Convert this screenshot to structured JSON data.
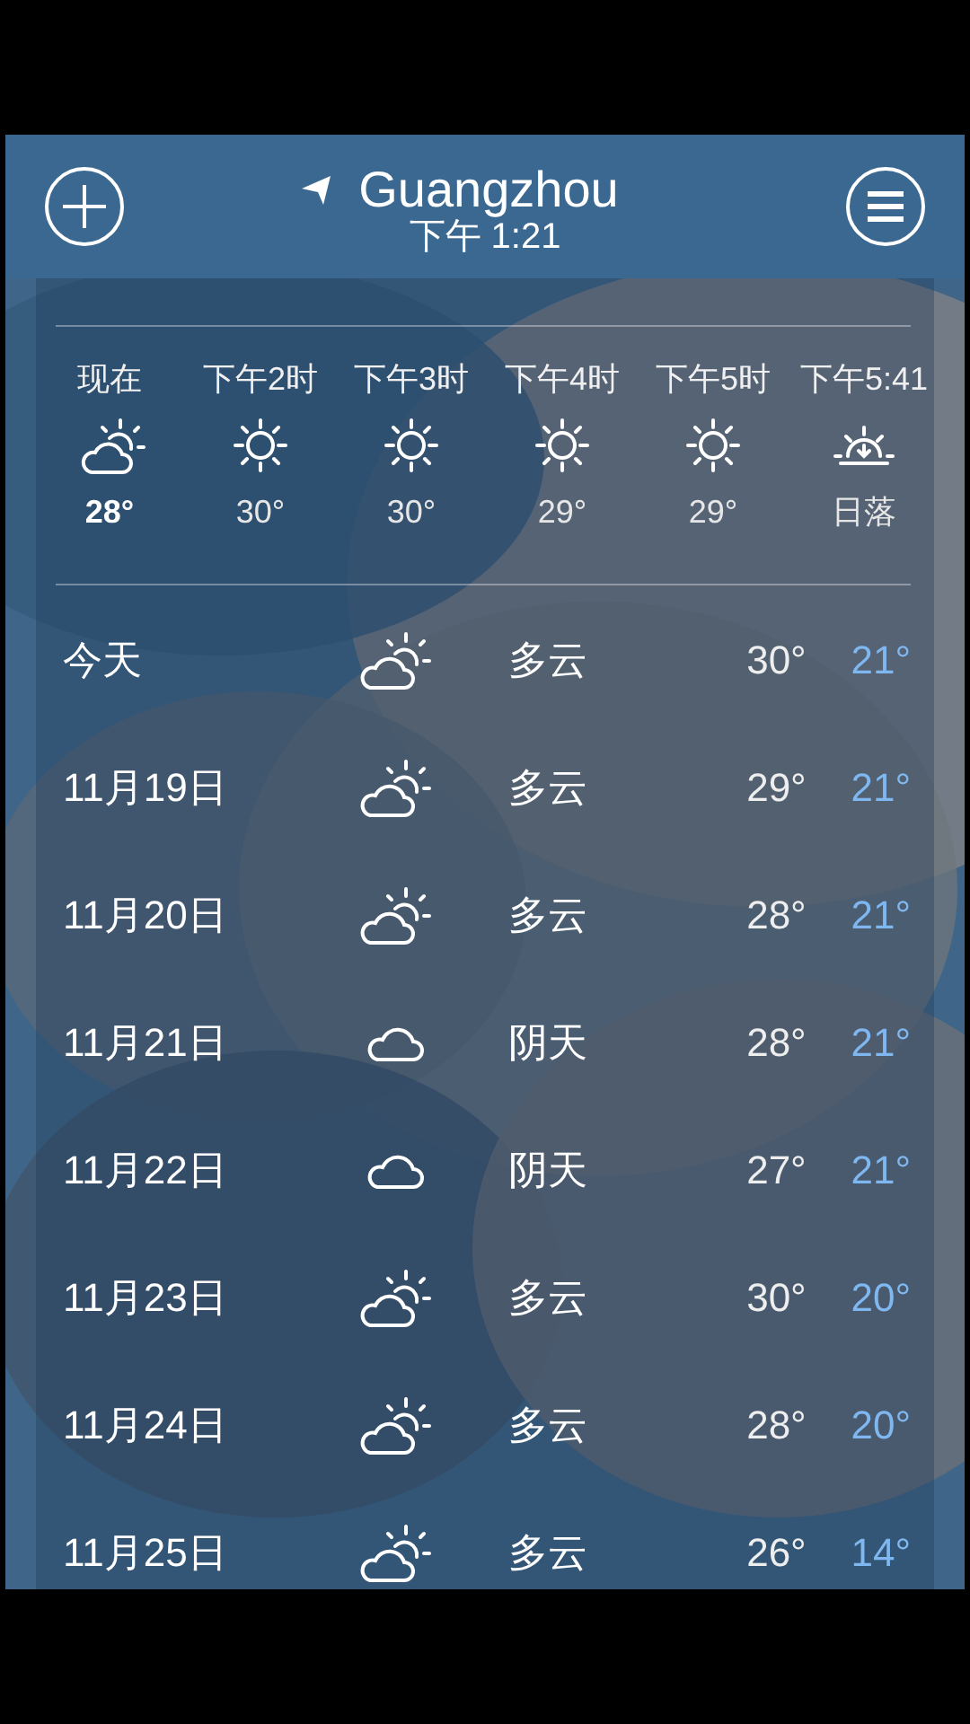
{
  "header": {
    "city": "Guangzhou",
    "time": "下午 1:21"
  },
  "hourly": [
    {
      "label": "现在",
      "kind": "partly_cloudy",
      "temp": "28°",
      "current": true
    },
    {
      "label": "下午2时",
      "kind": "sunny",
      "temp": "30°",
      "current": false
    },
    {
      "label": "下午3时",
      "kind": "sunny",
      "temp": "30°",
      "current": false
    },
    {
      "label": "下午4时",
      "kind": "sunny",
      "temp": "29°",
      "current": false
    },
    {
      "label": "下午5时",
      "kind": "sunny",
      "temp": "29°",
      "current": false
    },
    {
      "label": "下午5:41",
      "kind": "sunset",
      "temp": "日落",
      "current": false
    }
  ],
  "daily": [
    {
      "day": "今天",
      "kind": "partly_cloudy",
      "condition": "多云",
      "high": "30°",
      "low": "21°"
    },
    {
      "day": "11月19日",
      "kind": "partly_cloudy",
      "condition": "多云",
      "high": "29°",
      "low": "21°"
    },
    {
      "day": "11月20日",
      "kind": "partly_cloudy",
      "condition": "多云",
      "high": "28°",
      "low": "21°"
    },
    {
      "day": "11月21日",
      "kind": "cloudy",
      "condition": "阴天",
      "high": "28°",
      "low": "21°"
    },
    {
      "day": "11月22日",
      "kind": "cloudy",
      "condition": "阴天",
      "high": "27°",
      "low": "21°"
    },
    {
      "day": "11月23日",
      "kind": "partly_cloudy",
      "condition": "多云",
      "high": "30°",
      "low": "20°"
    },
    {
      "day": "11月24日",
      "kind": "partly_cloudy",
      "condition": "多云",
      "high": "28°",
      "low": "20°"
    },
    {
      "day": "11月25日",
      "kind": "partly_cloudy",
      "condition": "多云",
      "high": "26°",
      "low": "14°"
    }
  ]
}
